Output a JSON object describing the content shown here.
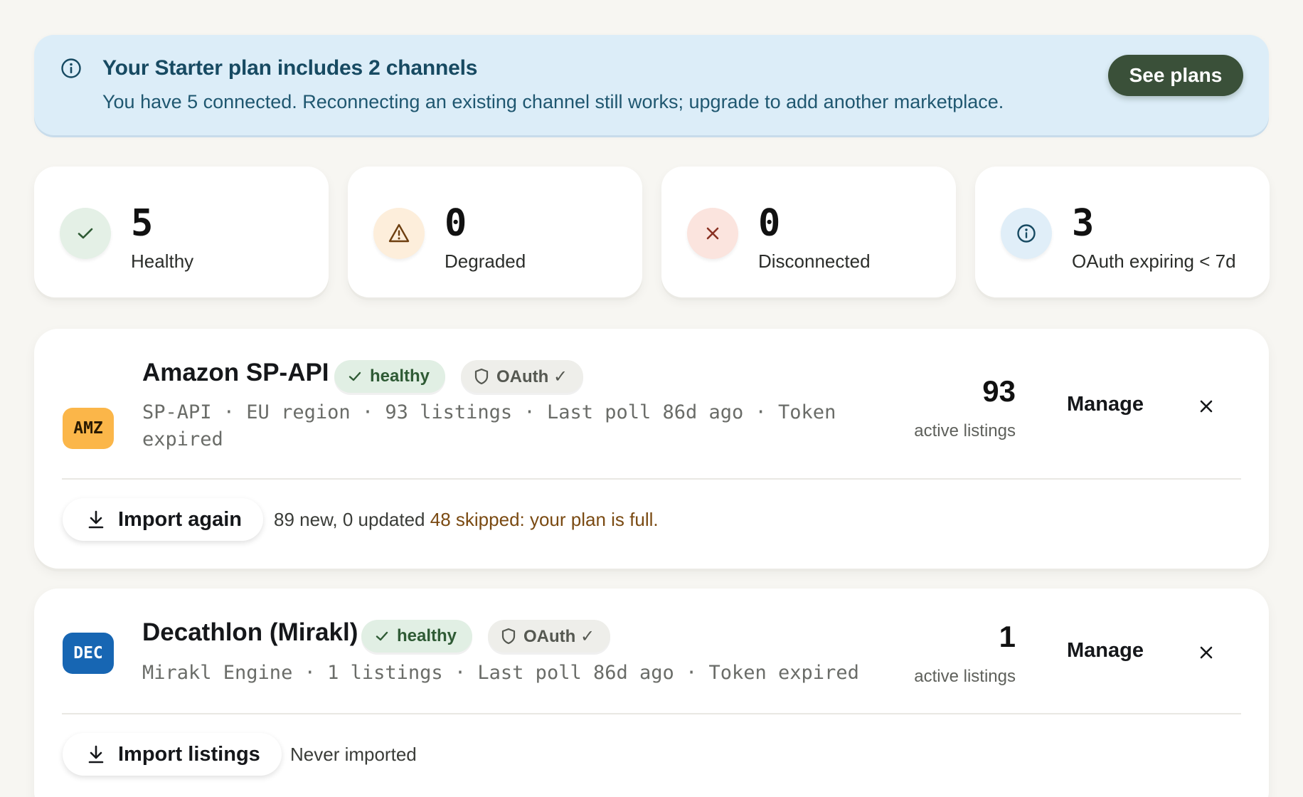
{
  "banner": {
    "title": "Your Starter plan includes 2 channels",
    "text": "You have 5 connected. Reconnecting an existing channel still works; upgrade to add another marketplace.",
    "button": "See plans",
    "icon": "info-icon"
  },
  "stats": [
    {
      "value": "5",
      "label": "Healthy",
      "icon": "check-icon",
      "color": "#2f5b35",
      "bg": "#e4f0e6"
    },
    {
      "value": "0",
      "label": "Degraded",
      "icon": "warning-icon",
      "color": "#8a4f12",
      "bg": "#fdeedb"
    },
    {
      "value": "0",
      "label": "Disconnected",
      "icon": "x-icon",
      "color": "#9a3a2a",
      "bg": "#fbe4de"
    },
    {
      "value": "3",
      "label": "OAuth expiring < 7d",
      "icon": "info-icon",
      "color": "#1f5770",
      "bg": "#e0eef8"
    }
  ],
  "channels": [
    {
      "logo": "AMZ",
      "logo_bg": "#fbb649",
      "logo_color": "#2a1a00",
      "name": "Amazon SP-API",
      "status": "healthy",
      "auth": "OAuth ✓",
      "meta_line1": "SP-API · EU region · 93 listings · Last poll 86d ago · Token",
      "meta_line2": "expired",
      "count": "93",
      "count_label": "active listings",
      "manage": "Manage",
      "import_label": "Import again",
      "import_note": "89 new, 0 updated",
      "import_warning": "48 skipped: your plan is full."
    },
    {
      "logo": "DEC",
      "logo_bg": "#1766b3",
      "logo_color": "#ffffff",
      "name": "Decathlon (Mirakl)",
      "status": "healthy",
      "auth": "OAuth ✓",
      "meta_line1": "Mirakl Engine · 1 listings · Last poll 86d ago · Token expired",
      "count": "1",
      "count_label": "active listings",
      "manage": "Manage",
      "import_label": "Import listings",
      "import_note": "Never imported"
    }
  ]
}
